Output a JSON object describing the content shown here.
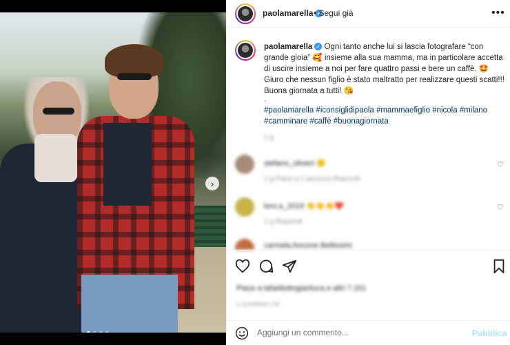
{
  "post": {
    "username": "paolamarella",
    "follow_label": "Segui già",
    "more_label": "•••",
    "caption_user": "paolamarella",
    "caption_text": "Ogni tanto anche lui si lascia fotografare “con grande gioia” 🥰 insieme alla sua mamma, ma in particolare accetta di uscire insieme a noi per fare quattro passi e bere un caffè. 🤩 Giuro che nessun figlio è stato maltratto per realizzare questi scatti!!! Buona giornata a tutti! 😘",
    "caption_dot": ".",
    "hashtags": "#paolamarella #iconsiglidipaola #mammaefiglio #nicola #milano #camminare #caffè #buonagiornata",
    "caption_time": "1 g",
    "next_label": "›"
  },
  "comments": [
    {
      "name": "stefano_olivieri 🙂",
      "meta": "1 g   Piace a 1 persona   Rispondi"
    },
    {
      "name": "loro.a_2019 👏👏👏❤️",
      "meta": "1 g   Rispondi"
    },
    {
      "name": "carmela.forcone Bellissimi",
      "meta": ""
    }
  ],
  "footer": {
    "likes": "Piace a lafaidiottogianluca e altri 7.151",
    "date": "1 GIORNO FA",
    "comment_placeholder": "Aggiungi un commento...",
    "publish_label": "Pubblica"
  },
  "colors": {
    "verified": "#3897f0",
    "hashtag": "#00376b",
    "publish": "#b2dffc",
    "plaid": "#b22b2b"
  },
  "icons": [
    "heart-icon",
    "comment-icon",
    "share-icon",
    "bookmark-icon",
    "emoji-icon",
    "verified-icon",
    "chevron-right-icon"
  ]
}
